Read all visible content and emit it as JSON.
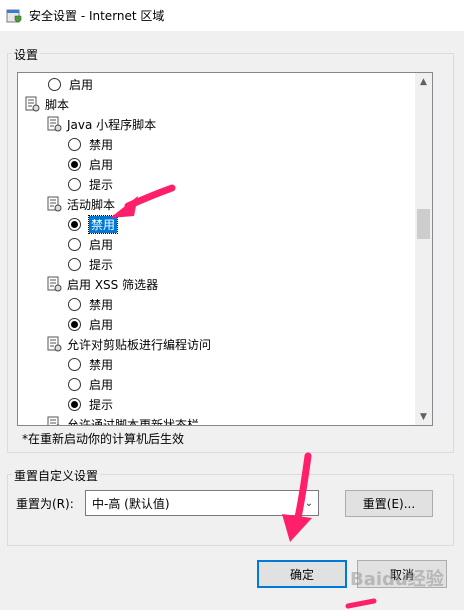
{
  "window": {
    "title": "安全设置 - Internet 区域"
  },
  "settings_group": {
    "legend": "设置"
  },
  "tree": [
    {
      "kind": "radio",
      "indent": 1,
      "label": "启用",
      "checked": false
    },
    {
      "kind": "category",
      "indent": 0,
      "label": "脚本"
    },
    {
      "kind": "category",
      "indent": 1,
      "label": "Java 小程序脚本"
    },
    {
      "kind": "radio",
      "indent": 2,
      "label": "禁用",
      "checked": false
    },
    {
      "kind": "radio",
      "indent": 2,
      "label": "启用",
      "checked": true
    },
    {
      "kind": "radio",
      "indent": 2,
      "label": "提示",
      "checked": false
    },
    {
      "kind": "category",
      "indent": 1,
      "label": "活动脚本"
    },
    {
      "kind": "radio",
      "indent": 2,
      "label": "禁用",
      "checked": true,
      "selected": true
    },
    {
      "kind": "radio",
      "indent": 2,
      "label": "启用",
      "checked": false
    },
    {
      "kind": "radio",
      "indent": 2,
      "label": "提示",
      "checked": false
    },
    {
      "kind": "category",
      "indent": 1,
      "label": "启用 XSS 筛选器"
    },
    {
      "kind": "radio",
      "indent": 2,
      "label": "禁用",
      "checked": false
    },
    {
      "kind": "radio",
      "indent": 2,
      "label": "启用",
      "checked": true
    },
    {
      "kind": "category",
      "indent": 1,
      "label": "允许对剪贴板进行编程访问"
    },
    {
      "kind": "radio",
      "indent": 2,
      "label": "禁用",
      "checked": false
    },
    {
      "kind": "radio",
      "indent": 2,
      "label": "启用",
      "checked": false
    },
    {
      "kind": "radio",
      "indent": 2,
      "label": "提示",
      "checked": true
    },
    {
      "kind": "category",
      "indent": 1,
      "label": "允许通过脚本更新状态栏"
    }
  ],
  "restart_note": "*在重新启动你的计算机后生效",
  "reset_group": {
    "legend": "重置自定义设置",
    "reset_to_label": "重置为(R):",
    "reset_value": "中-高 (默认值)",
    "reset_button": "重置(E)..."
  },
  "footer": {
    "ok_button": "确定",
    "cancel_button": "取消"
  },
  "watermark": "Baidu经验",
  "colors": {
    "selection": "#0078d7",
    "annotation_arrow": "#ff1f6b"
  }
}
